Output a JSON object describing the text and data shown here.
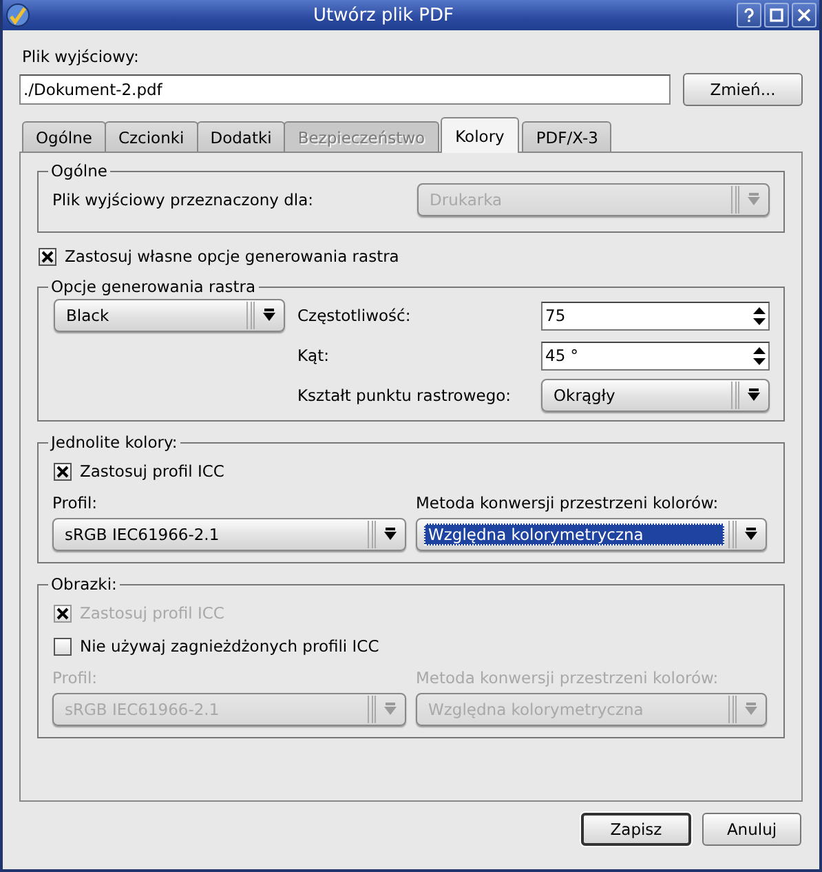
{
  "window": {
    "title": "Utwórz plik PDF"
  },
  "output_file": {
    "label": "Plik wyjściowy:",
    "value": "./Dokument-2.pdf",
    "button": "Zmień..."
  },
  "tabs": [
    {
      "label": "Ogólne",
      "selected": false,
      "disabled": false
    },
    {
      "label": "Czcionki",
      "selected": false,
      "disabled": false
    },
    {
      "label": "Dodatki",
      "selected": false,
      "disabled": false
    },
    {
      "label": "Bezpieczeństwo",
      "selected": false,
      "disabled": true
    },
    {
      "label": "Kolory",
      "selected": true,
      "disabled": false
    },
    {
      "label": "PDF/X-3",
      "selected": false,
      "disabled": false
    }
  ],
  "general": {
    "title": "Ogólne",
    "target_label": "Plik wyjściowy przeznaczony dla:",
    "target_combo": {
      "value": "Drukarka",
      "disabled": true,
      "highlighted": false
    }
  },
  "custom_raster": {
    "label": "Zastosuj własne opcje generowania rastra",
    "checked": true,
    "disabled": false
  },
  "raster": {
    "title": "Opcje generowania rastra",
    "color_combo": {
      "value": "Black",
      "disabled": false,
      "highlighted": false
    },
    "frequency": {
      "label": "Częstotliwość:",
      "value": "75"
    },
    "angle": {
      "label": "Kąt:",
      "value": "45 °"
    },
    "dot_shape": {
      "label": "Kształt punktu rastrowego:",
      "combo": {
        "value": "Okrągły",
        "disabled": false,
        "highlighted": false
      }
    }
  },
  "solid_colors": {
    "title": "Jednolite kolory:",
    "checkboxes": [
      {
        "label": "Zastosuj profil ICC",
        "checked": true,
        "disabled": false
      }
    ],
    "profile_label": "Profil:",
    "profile_combo": {
      "value": "sRGB IEC61966-2.1",
      "disabled": false,
      "highlighted": false
    },
    "method_label": "Metoda konwersji przestrzeni kolorów:",
    "method_combo": {
      "value": "Względna kolorymetryczna",
      "disabled": false,
      "highlighted": true
    },
    "disabled": false
  },
  "images": {
    "title": "Obrazki:",
    "checkboxes": [
      {
        "label": "Zastosuj profil ICC",
        "checked": true,
        "disabled": true
      },
      {
        "label": "Nie używaj zagnieżdżonych profili ICC",
        "checked": false,
        "disabled": false
      }
    ],
    "profile_label": "Profil:",
    "profile_combo": {
      "value": "sRGB IEC61966-2.1",
      "disabled": true,
      "highlighted": false
    },
    "method_label": "Metoda konwersji przestrzeni kolorów:",
    "method_combo": {
      "value": "Względna kolorymetryczna",
      "disabled": true,
      "highlighted": false
    },
    "disabled": true
  },
  "buttons": [
    {
      "label": "Zapisz",
      "default": true
    },
    {
      "label": "Anuluj",
      "default": false
    }
  ]
}
